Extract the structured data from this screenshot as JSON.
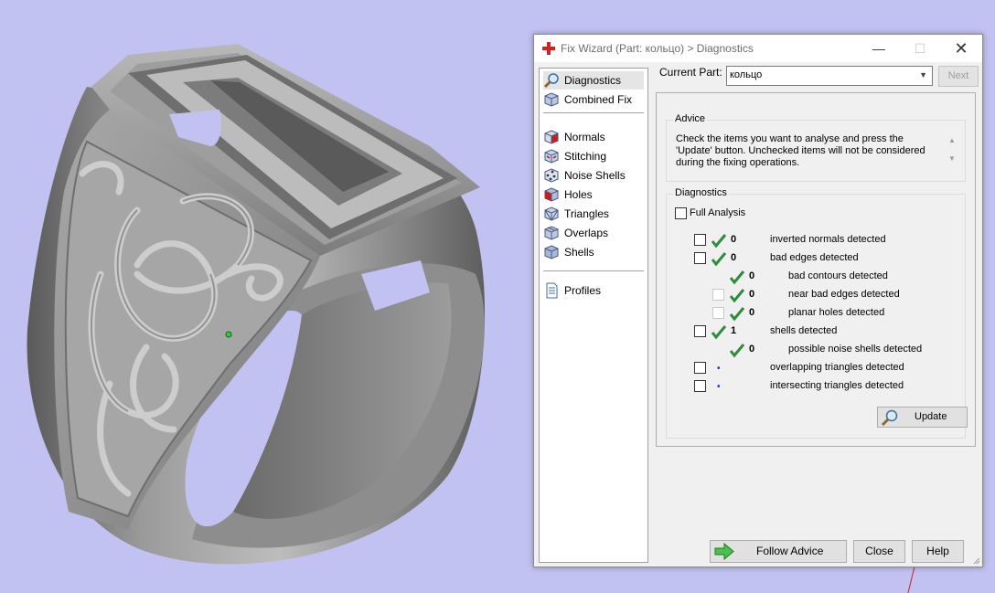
{
  "window": {
    "title": "Fix Wizard (Part: кольцо) > Diagnostics",
    "minimize": "—",
    "maximize": "☐",
    "close": "✕",
    "icon": "red-cross-icon"
  },
  "nav": {
    "items": [
      {
        "label": "Diagnostics",
        "icon": "magnifier-icon",
        "active": true
      },
      {
        "label": "Combined Fix",
        "icon": "cube-icon"
      },
      {
        "label": "Normals",
        "icon": "red-cube-icon"
      },
      {
        "label": "Stitching",
        "icon": "stitch-cube-icon"
      },
      {
        "label": "Noise Shells",
        "icon": "dotted-cube-icon"
      },
      {
        "label": "Holes",
        "icon": "hole-cube-icon"
      },
      {
        "label": "Triangles",
        "icon": "triangle-cube-icon"
      },
      {
        "label": "Overlaps",
        "icon": "overlap-cube-icon"
      },
      {
        "label": "Shells",
        "icon": "shell-cube-icon"
      },
      {
        "label": "Profiles",
        "icon": "document-icon"
      }
    ]
  },
  "current_part": {
    "label": "Current Part:",
    "value": "кольцо",
    "next_label": "Next"
  },
  "advice": {
    "title": "Advice",
    "text": "Check the items you want to analyse and press the 'Update' button. Unchecked items will not be considered during the fixing operations."
  },
  "diagnostics": {
    "title": "Diagnostics",
    "full_analysis_label": "Full Analysis",
    "rows": [
      {
        "count": "0",
        "label": "inverted normals detected",
        "status": "ok"
      },
      {
        "count": "0",
        "label": "bad edges detected",
        "status": "ok"
      },
      {
        "count": "0",
        "label": "bad contours detected",
        "status": "ok"
      },
      {
        "count": "0",
        "label": "near bad edges detected",
        "status": "ok"
      },
      {
        "count": "0",
        "label": "planar holes detected",
        "status": "ok"
      },
      {
        "count": "1",
        "label": "shells detected",
        "status": "ok"
      },
      {
        "count": "0",
        "label": "possible noise shells detected",
        "status": "ok"
      },
      {
        "count": "•",
        "label": "overlapping triangles detected",
        "status": "pending"
      },
      {
        "count": "•",
        "label": "intersecting triangles detected",
        "status": "pending"
      }
    ],
    "update_label": "Update"
  },
  "buttons": {
    "follow_advice": "Follow Advice",
    "close": "Close",
    "help": "Help"
  },
  "colors": {
    "background": "#c2c2f2",
    "check_green": "#2e8b3a",
    "model_gray": "#9a9a9a"
  }
}
